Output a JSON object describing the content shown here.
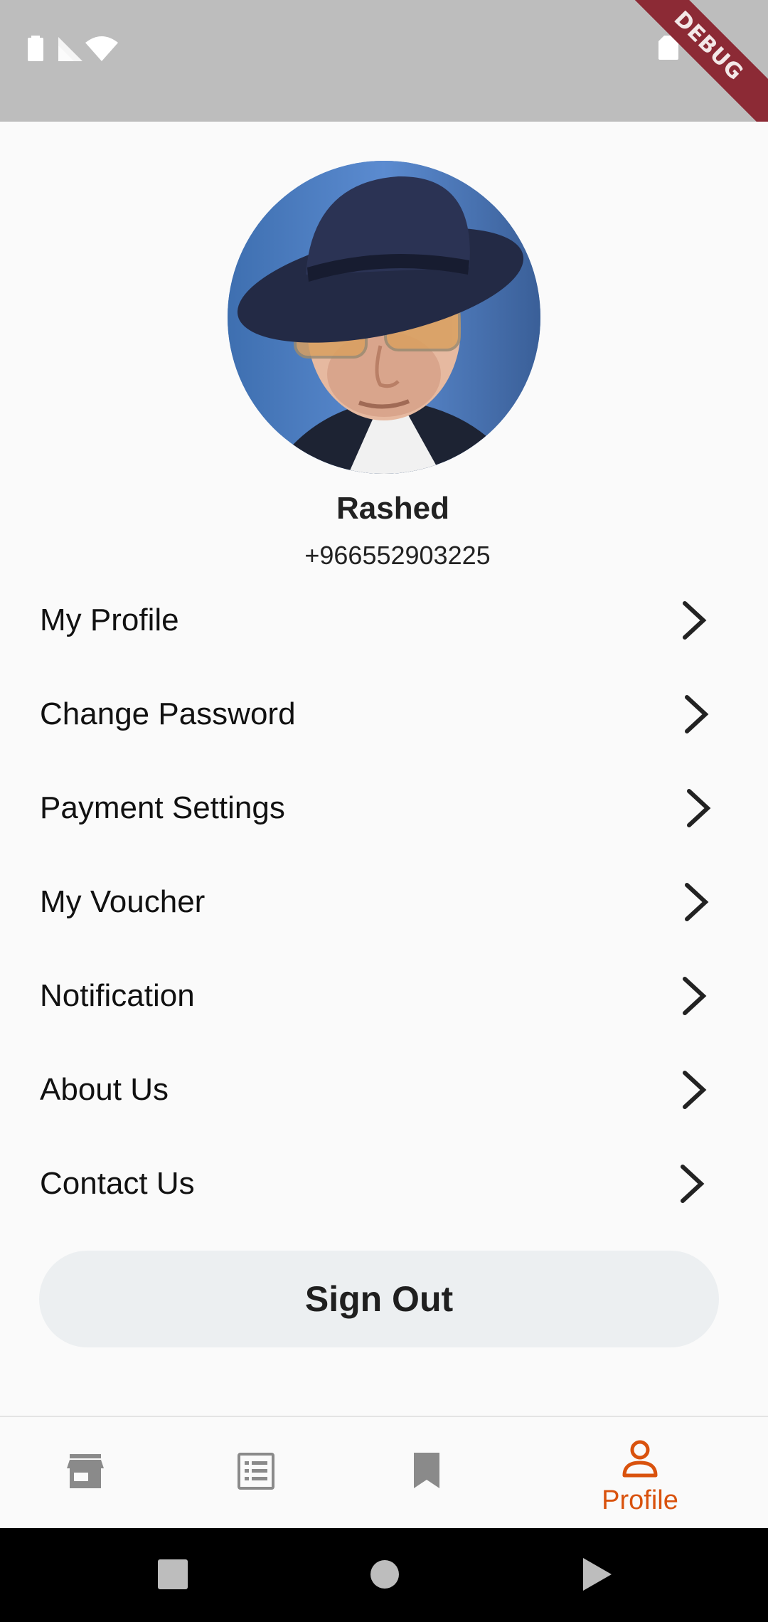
{
  "status_bar": {
    "debug_banner": "DEBUG",
    "icons": [
      "battery-icon",
      "signal-icon",
      "wifi-icon",
      "sd-card-icon",
      "notification-icon"
    ]
  },
  "profile": {
    "name": "Rashed",
    "phone": "+966552903225",
    "avatar": "user-photo"
  },
  "menu": [
    {
      "label": "My Profile"
    },
    {
      "label": "Change Password"
    },
    {
      "label": "Payment Settings"
    },
    {
      "label": "My Voucher"
    },
    {
      "label": "Notification"
    },
    {
      "label": "About Us"
    },
    {
      "label": "Contact Us"
    }
  ],
  "sign_out_label": "Sign Out",
  "bottom_nav": {
    "items": [
      {
        "icon": "store-icon",
        "label": "",
        "active": false
      },
      {
        "icon": "list-icon",
        "label": "",
        "active": false
      },
      {
        "icon": "bookmark-icon",
        "label": "",
        "active": false
      },
      {
        "icon": "person-icon",
        "label": "Profile",
        "active": true
      }
    ],
    "active_color": "#d9520d",
    "inactive_color": "#8a8a8a"
  },
  "system_nav": {
    "icons": [
      "recents-icon",
      "home-icon",
      "back-icon"
    ]
  }
}
